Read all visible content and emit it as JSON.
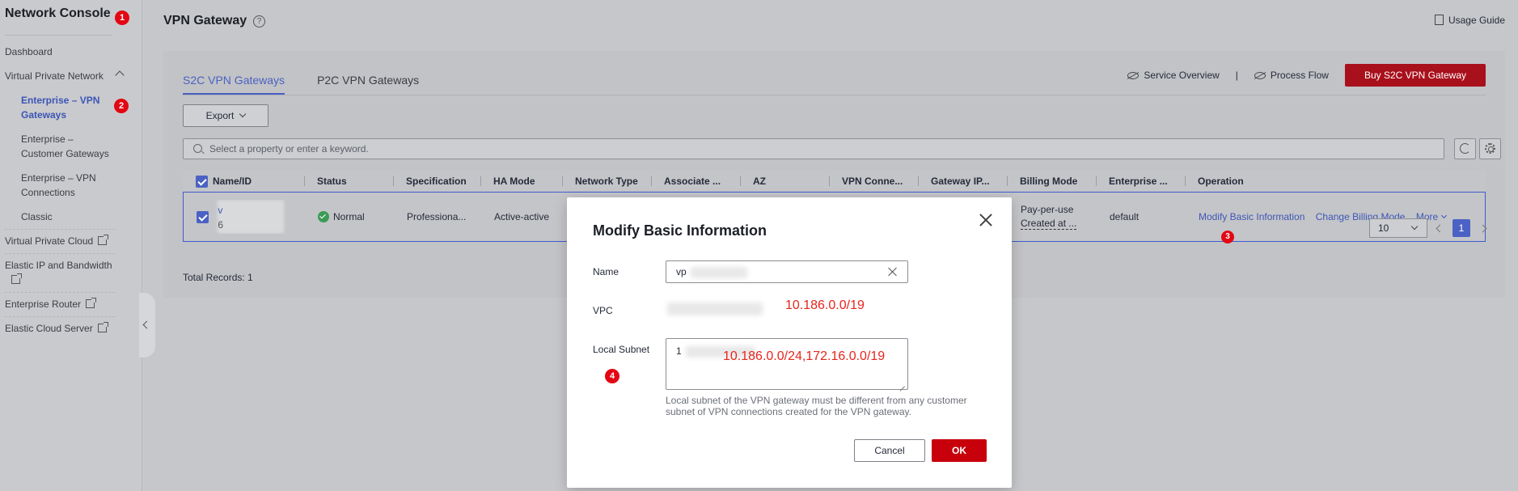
{
  "sidebar": {
    "title": "Network Console",
    "items": [
      {
        "label": "Dashboard"
      },
      {
        "label": "Virtual Private Network"
      },
      {
        "label": "Enterprise – VPN Gateways"
      },
      {
        "label": "Enterprise – Customer Gateways"
      },
      {
        "label": "Enterprise – VPN Connections"
      },
      {
        "label": "Classic"
      },
      {
        "label": "Virtual Private Cloud"
      },
      {
        "label": "Elastic IP and Bandwidth"
      },
      {
        "label": "Enterprise Router"
      },
      {
        "label": "Elastic Cloud Server"
      }
    ]
  },
  "badges": [
    "1",
    "2",
    "3",
    "4"
  ],
  "header": {
    "title": "VPN Gateway",
    "help": "?",
    "usage_guide": "Usage Guide"
  },
  "tabs": [
    {
      "label": "S2C VPN Gateways",
      "active": true
    },
    {
      "label": "P2C VPN Gateways",
      "active": false
    }
  ],
  "actions": {
    "service_overview": "Service Overview",
    "divider": "|",
    "process_flow": "Process Flow",
    "buy": "Buy S2C VPN Gateway"
  },
  "toolbar": {
    "export": "Export",
    "search_placeholder": "Select a property or enter a keyword."
  },
  "table": {
    "columns": [
      "Name/ID",
      "Status",
      "Specification",
      "HA Mode",
      "Network Type",
      "Associate ...",
      "AZ",
      "VPN Conne...",
      "Gateway IP...",
      "Billing Mode",
      "Enterprise ...",
      "Operation"
    ],
    "row": {
      "name_visible": "v",
      "id_visible": "6",
      "status": "Normal",
      "specification": "Professiona...",
      "ha_mode": "Active-active",
      "billing_line1": "Pay-per-use",
      "billing_line2": "Created at ...",
      "enterprise": "default",
      "op_modify": "Modify Basic Information",
      "op_change_billing": "Change Billing Mode",
      "op_more": "More"
    },
    "total": "Total Records: 1"
  },
  "pagination": {
    "page_size": "10",
    "current_page": "1"
  },
  "modal": {
    "title": "Modify Basic Information",
    "name_label": "Name",
    "name_value": "vp",
    "vpc_label": "VPC",
    "vpc_note": "10.186.0.0/19",
    "subnet_label": "Local Subnet",
    "subnet_prefix": "1",
    "subnet_note": "10.186.0.0/24,172.16.0.0/19",
    "hint": "Local subnet of the VPN gateway must be different from any customer subnet of VPN connections created for the VPN gateway.",
    "cancel": "Cancel",
    "ok": "OK"
  },
  "colors": {
    "accent": "#4a61c2",
    "primary_red": "#c7000b",
    "badge_red": "#e30613",
    "annotation_red": "#e8251d"
  }
}
